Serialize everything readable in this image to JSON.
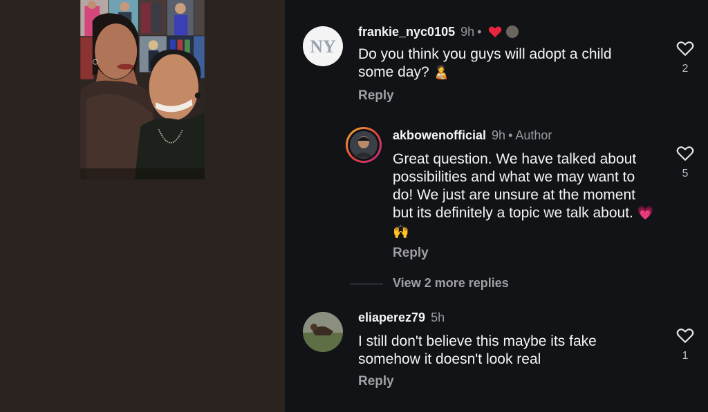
{
  "comments": [
    {
      "username": "frankie_nyc0105",
      "time": "9h",
      "text": "Do you think you guys will adopt a child some day?",
      "emoji": "🧑‍🍼",
      "reply_label": "Reply",
      "like_count": "2",
      "liked_by_author": true,
      "avatar_icon": "yankees-logo-icon"
    },
    {
      "username": "akbowenofficial",
      "time": "9h",
      "author_label": "Author",
      "text": "Great question. We have talked about possibilities and what we may want to do! We just are unsure at the moment but its definitely a topic we talk about.",
      "emoji": "💗🙌",
      "reply_label": "Reply",
      "like_count": "5",
      "avatar_icon": "profile-photo-icon",
      "view_more_label": "View 2 more replies"
    },
    {
      "username": "eliaperez79",
      "time": "5h",
      "text": "I still don't believe this maybe its fake somehow it doesn't look real",
      "reply_label": "Reply",
      "like_count": "1",
      "avatar_icon": "dog-photo-icon"
    }
  ],
  "colors": {
    "background": "#111317",
    "heart_red": "#e8253f",
    "story_ring_start": "#f9b233",
    "story_ring_end": "#c1268c"
  }
}
